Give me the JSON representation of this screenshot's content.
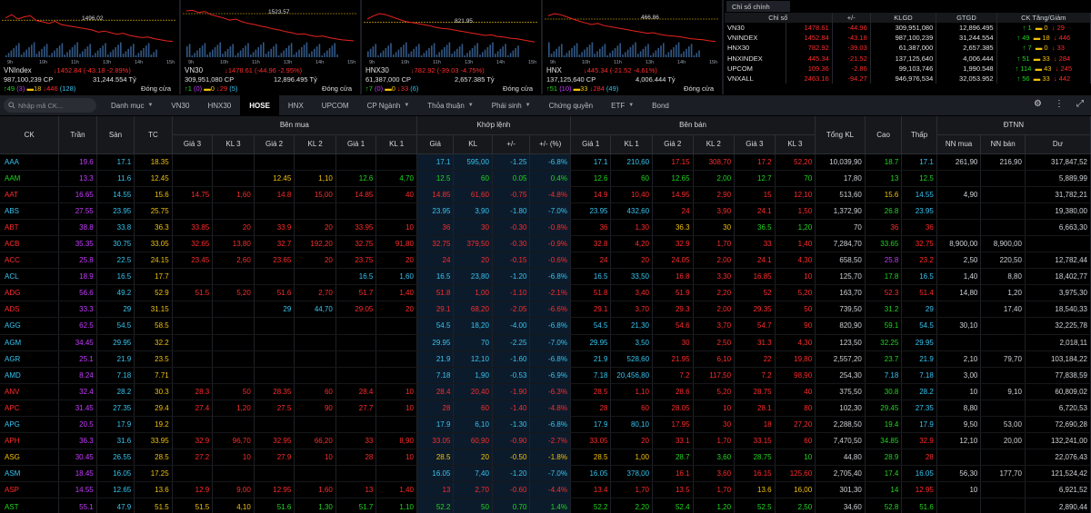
{
  "charts": [
    {
      "name": "VNIndex",
      "level": "1496.02",
      "change": "↓1452.84 (-43.18 -2.89%)",
      "volume": "987,100,239 CP",
      "value": "31,244.554 Tỷ",
      "up": "↑49",
      "ce": "(3)",
      "ref": "▬18",
      "down": "↓446",
      "fl": "(128)",
      "status": "Đóng cửa",
      "line_color": "#e8231d",
      "ref_y": 0.32,
      "line": [
        0.28,
        0.22,
        0.3,
        0.26,
        0.24,
        0.33,
        0.35,
        0.38,
        0.34,
        0.4,
        0.42,
        0.44,
        0.46,
        0.48,
        0.5,
        0.54,
        0.52,
        0.55,
        0.58,
        0.56,
        0.6,
        0.62,
        0.64,
        0.63,
        0.66,
        0.68,
        0.7,
        0.71
      ]
    },
    {
      "name": "VN30",
      "level": "1523.57",
      "change": "↓1478.61 (-44.96 -2.95%)",
      "volume": "309,951,080 CP",
      "value": "12,896.495 Tỷ",
      "up": "↑1",
      "ce": "(0)",
      "ref": "▬0",
      "down": "↓29",
      "fl": "(5)",
      "status": "Đóng cửa",
      "line_color": "#e8231d",
      "ref_y": 0.2,
      "line": [
        0.15,
        0.14,
        0.18,
        0.16,
        0.22,
        0.25,
        0.28,
        0.32,
        0.3,
        0.35,
        0.38,
        0.4,
        0.43,
        0.45,
        0.48,
        0.5,
        0.53,
        0.55,
        0.58,
        0.57,
        0.6,
        0.62,
        0.61,
        0.64,
        0.66,
        0.68,
        0.69,
        0.7
      ]
    },
    {
      "name": "HNX30",
      "level": "821.95",
      "change": "↓782.92 (-39.03 -4.75%)",
      "volume": "61,387,000 CP",
      "value": "2,657.385 Tỷ",
      "up": "↑7",
      "ce": "(0)",
      "ref": "▬0",
      "down": "↓33",
      "fl": "(6)",
      "status": "Đóng cửa",
      "line_color": "#e8231d",
      "ref_y": 0.36,
      "line": [
        0.3,
        0.24,
        0.2,
        0.22,
        0.26,
        0.3,
        0.34,
        0.36,
        0.38,
        0.4,
        0.42,
        0.45,
        0.47,
        0.48,
        0.5,
        0.52,
        0.54,
        0.56,
        0.58,
        0.6,
        0.59,
        0.62,
        0.63,
        0.65,
        0.66,
        0.68,
        0.7,
        0.72
      ]
    },
    {
      "name": "HNX",
      "level": "466.86",
      "change": "↓445.34 (-21.52 -4.61%)",
      "volume": "137,125,640 CP",
      "value": "4,006.444 Tỷ",
      "up": "↑51",
      "ce": "(10)",
      "ref": "▬33",
      "down": "↓284",
      "fl": "(49)",
      "status": "Đóng cửa",
      "line_color": "#e8231d",
      "ref_y": 0.3,
      "line": [
        0.24,
        0.2,
        0.22,
        0.26,
        0.3,
        0.34,
        0.37,
        0.4,
        0.38,
        0.42,
        0.44,
        0.46,
        0.48,
        0.5,
        0.52,
        0.54,
        0.56,
        0.55,
        0.58,
        0.6,
        0.61,
        0.62,
        0.64,
        0.66,
        0.67,
        0.68,
        0.7,
        0.71
      ]
    }
  ],
  "index_panel": {
    "tab": "Chỉ số chính",
    "headers": [
      "Chỉ số",
      "+/-",
      "KLGD",
      "GTGD",
      "CK Tăng/Giảm"
    ],
    "rows": [
      {
        "name": "VN30",
        "value": "1478.61",
        "chg": "-44.96",
        "vol": "309,951,080",
        "val": "12,896.495",
        "up": "↑ 1",
        "ref": "▬ 0",
        "down": "↓ 29"
      },
      {
        "name": "VNINDEX",
        "value": "1452.84",
        "chg": "-43.18",
        "vol": "987,100,239",
        "val": "31,244.554",
        "up": "↑ 49",
        "ref": "▬ 18",
        "down": "↓ 446"
      },
      {
        "name": "HNX30",
        "value": "782.92",
        "chg": "-39.03",
        "vol": "61,387,000",
        "val": "2,657.385",
        "up": "↑ 7",
        "ref": "▬ 0",
        "down": "↓ 33"
      },
      {
        "name": "HNXINDEX",
        "value": "445.34",
        "chg": "-21.52",
        "vol": "137,125,640",
        "val": "4,006.444",
        "up": "↑ 51",
        "ref": "▬ 33",
        "down": "↓ 284"
      },
      {
        "name": "UPCOM",
        "value": "109.36",
        "chg": "-2.86",
        "vol": "99,103,746",
        "val": "1,990.548",
        "up": "↑ 114",
        "ref": "▬ 43",
        "down": "↓ 245"
      },
      {
        "name": "VNXALL",
        "value": "2463.16",
        "chg": "-94.27",
        "vol": "946,976,534",
        "val": "32,053.952",
        "up": "↑ 56",
        "ref": "▬ 33",
        "down": "↓ 442"
      }
    ]
  },
  "toolbar": {
    "search_placeholder": "Nhập mã CK...",
    "tabs": [
      {
        "label": "Danh mục",
        "chev": true
      },
      {
        "label": "VN30",
        "chev": false
      },
      {
        "label": "HNX30",
        "chev": false
      },
      {
        "label": "HOSE",
        "chev": false,
        "active": true
      },
      {
        "label": "HNX",
        "chev": false
      },
      {
        "label": "UPCOM",
        "chev": false
      },
      {
        "label": "CP Ngành",
        "chev": true
      },
      {
        "label": "Thỏa thuận",
        "chev": true
      },
      {
        "label": "Phái sinh",
        "chev": true
      },
      {
        "label": "Chứng quyền",
        "chev": false
      },
      {
        "label": "ETF",
        "chev": true
      },
      {
        "label": "Bond",
        "chev": false
      }
    ]
  },
  "board": {
    "groups": {
      "buy": "Bên mua",
      "match": "Khớp lệnh",
      "sell": "Bên bán",
      "foreign": "ĐTNN"
    },
    "fixed_headers": {
      "ck": "CK",
      "ceil": "Trần",
      "floor": "Sàn",
      "ref": "TC",
      "total": "Tổng KL",
      "high": "Cao",
      "low": "Thấp"
    },
    "sub_headers": [
      "Giá 3",
      "KL 3",
      "Giá 2",
      "KL 2",
      "Giá 1",
      "KL 1",
      "Giá",
      "KL",
      "+/-",
      "+/- (%)",
      "Giá 1",
      "KL 1",
      "Giá 2",
      "KL 2",
      "Giá 3",
      "KL 3",
      "NN mua",
      "NN bán",
      "Dư"
    ],
    "rows": [
      [
        "AAA",
        "19.6",
        "17.1",
        "18.35",
        "",
        "",
        "",
        "",
        "",
        "",
        "17.1",
        "595,00",
        "-1.25",
        "-6.8%",
        "17.1",
        "210,60",
        "17.15",
        "308,70",
        "17.2",
        "52,20",
        "10,039,90",
        "18.7",
        "17.1",
        "261,90",
        "216,90",
        "317,847,52"
      ],
      [
        "AAM",
        "13.3",
        "11.6",
        "12.45",
        "",
        "",
        "12.45",
        "1,10",
        "12.6",
        "4,70",
        "12.5",
        "60",
        "0.05",
        "0.4%",
        "12.6",
        "60",
        "12.65",
        "2,00",
        "12.7",
        "70",
        "17,80",
        "13",
        "12.5",
        "",
        "",
        "5,889,99"
      ],
      [
        "AAT",
        "16.65",
        "14.55",
        "15.6",
        "14.75",
        "1,60",
        "14.8",
        "15,00",
        "14.85",
        "40",
        "14.85",
        "61,60",
        "-0.75",
        "-4.8%",
        "14.9",
        "10,40",
        "14.95",
        "2,90",
        "15",
        "12,10",
        "513,60",
        "15.6",
        "14.55",
        "4,90",
        "",
        "31,782,21"
      ],
      [
        "ABS",
        "27.55",
        "23.95",
        "25.75",
        "",
        "",
        "",
        "",
        "",
        "",
        "23.95",
        "3,90",
        "-1.80",
        "-7.0%",
        "23.95",
        "432,60",
        "24",
        "3,90",
        "24.1",
        "1,50",
        "1,372,90",
        "26.8",
        "23.95",
        "",
        "",
        "19,380,00"
      ],
      [
        "ABT",
        "38.8",
        "33.8",
        "36.3",
        "33.85",
        "20",
        "33.9",
        "20",
        "33.95",
        "10",
        "36",
        "30",
        "-0.30",
        "-0.8%",
        "36",
        "1,30",
        "36.3",
        "30",
        "36.5",
        "1,20",
        "70",
        "36",
        "36",
        "",
        "",
        "6,663,30"
      ],
      [
        "ACB",
        "35.35",
        "30.75",
        "33.05",
        "32.65",
        "13,80",
        "32.7",
        "192,20",
        "32.75",
        "91,80",
        "32.75",
        "379,50",
        "-0.30",
        "-0.9%",
        "32.8",
        "4,20",
        "32.9",
        "1,70",
        "33",
        "1,40",
        "7,284,70",
        "33.65",
        "32.75",
        "8,900,00",
        "8,900,00",
        ""
      ],
      [
        "ACC",
        "25.8",
        "22.5",
        "24.15",
        "23.45",
        "2,60",
        "23.65",
        "20",
        "23.75",
        "20",
        "24",
        "20",
        "-0.15",
        "-0.6%",
        "24",
        "20",
        "24.05",
        "2,00",
        "24.1",
        "4,30",
        "658,50",
        "25.8",
        "23.2",
        "2,50",
        "220,50",
        "12,782,44"
      ],
      [
        "ACL",
        "18.9",
        "16.5",
        "17.7",
        "",
        "",
        "",
        "",
        "16.5",
        "1,60",
        "16.5",
        "23,80",
        "-1.20",
        "-6.8%",
        "16.5",
        "33,50",
        "16.8",
        "3,30",
        "16.85",
        "10",
        "125,70",
        "17.8",
        "16.5",
        "1,40",
        "8,80",
        "18,402,77"
      ],
      [
        "ADG",
        "56.6",
        "49.2",
        "52.9",
        "51.5",
        "5,20",
        "51.6",
        "2,70",
        "51.7",
        "1,40",
        "51.8",
        "1,00",
        "-1.10",
        "-2.1%",
        "51.8",
        "3,40",
        "51.9",
        "2,20",
        "52",
        "5,20",
        "163,70",
        "52.3",
        "51.4",
        "14,80",
        "1,20",
        "3,975,30"
      ],
      [
        "ADS",
        "33.3",
        "29",
        "31.15",
        "",
        "",
        "29",
        "44,70",
        "29.05",
        "20",
        "29.1",
        "68,20",
        "-2.05",
        "-6.6%",
        "29.1",
        "3,70",
        "29.3",
        "2,00",
        "29.35",
        "50",
        "739,50",
        "31.2",
        "29",
        "",
        "17,40",
        "18,540,33"
      ],
      [
        "AGG",
        "62.5",
        "54.5",
        "58.5",
        "",
        "",
        "",
        "",
        "",
        "",
        "54.5",
        "18,20",
        "-4.00",
        "-6.8%",
        "54.5",
        "21,30",
        "54.6",
        "3,70",
        "54.7",
        "90",
        "820,90",
        "59.1",
        "54.5",
        "30,10",
        "",
        "32,225,78"
      ],
      [
        "AGM",
        "34.45",
        "29.95",
        "32.2",
        "",
        "",
        "",
        "",
        "",
        "",
        "29.95",
        "70",
        "-2.25",
        "-7.0%",
        "29.95",
        "3,50",
        "30",
        "2,50",
        "31.3",
        "4,30",
        "123,50",
        "32.25",
        "29.95",
        "",
        "",
        "2,018,11"
      ],
      [
        "AGR",
        "25.1",
        "21.9",
        "23.5",
        "",
        "",
        "",
        "",
        "",
        "",
        "21.9",
        "12,10",
        "-1.60",
        "-6.8%",
        "21.9",
        "528,60",
        "21.95",
        "6,10",
        "22",
        "19,80",
        "2,557,20",
        "23.7",
        "21.9",
        "2,10",
        "79,70",
        "103,184,22"
      ],
      [
        "AMD",
        "8.24",
        "7.18",
        "7.71",
        "",
        "",
        "",
        "",
        "",
        "",
        "7.18",
        "1,90",
        "-0.53",
        "-6.9%",
        "7.18",
        "20,456,80",
        "7.2",
        "117,50",
        "7.2",
        "98,90",
        "254,30",
        "7.18",
        "7.18",
        "3,00",
        "",
        "77,838,59"
      ],
      [
        "ANV",
        "32.4",
        "28.2",
        "30.3",
        "28.3",
        "50",
        "28.35",
        "60",
        "28.4",
        "10",
        "28.4",
        "20,40",
        "-1.90",
        "-6.3%",
        "28.5",
        "1,10",
        "28.6",
        "5,20",
        "28.75",
        "40",
        "375,50",
        "30.8",
        "28.2",
        "10",
        "9,10",
        "60,809,02"
      ],
      [
        "APC",
        "31.45",
        "27.35",
        "29.4",
        "27.4",
        "1,20",
        "27.5",
        "90",
        "27.7",
        "10",
        "28",
        "60",
        "-1.40",
        "-4.8%",
        "28",
        "60",
        "28.05",
        "10",
        "28.1",
        "80",
        "102,30",
        "29.45",
        "27.35",
        "8,80",
        "",
        "6,720,53"
      ],
      [
        "APG",
        "20.5",
        "17.9",
        "19.2",
        "",
        "",
        "",
        "",
        "",
        "",
        "17.9",
        "6,10",
        "-1.30",
        "-6.8%",
        "17.9",
        "80,10",
        "17.95",
        "30",
        "18",
        "27,20",
        "2,288,50",
        "19.4",
        "17.9",
        "9,50",
        "53,00",
        "72,690,28"
      ],
      [
        "APH",
        "36.3",
        "31.6",
        "33.95",
        "32.9",
        "96,70",
        "32.95",
        "66,20",
        "33",
        "8,90",
        "33.05",
        "60,90",
        "-0.90",
        "-2.7%",
        "33.05",
        "20",
        "33.1",
        "1,70",
        "33.15",
        "60",
        "7,470,50",
        "34.85",
        "32.9",
        "12,10",
        "20,00",
        "132,241,00"
      ],
      [
        "ASG",
        "30.45",
        "26.55",
        "28.5",
        "27.2",
        "10",
        "27.9",
        "10",
        "28",
        "10",
        "28.5",
        "20",
        "-0.50",
        "-1.8%",
        "28.5",
        "1,00",
        "28.7",
        "3,60",
        "28.75",
        "10",
        "44,80",
        "28.9",
        "28",
        "",
        "",
        "22,076,43"
      ],
      [
        "ASM",
        "18.45",
        "16.05",
        "17.25",
        "",
        "",
        "",
        "",
        "",
        "",
        "16.05",
        "7,40",
        "-1.20",
        "-7.0%",
        "16.05",
        "378,00",
        "16.1",
        "3,60",
        "16.15",
        "125,60",
        "2,705,40",
        "17.4",
        "16.05",
        "56,30",
        "177,70",
        "121,524,42"
      ],
      [
        "ASP",
        "14.55",
        "12.65",
        "13.6",
        "12.9",
        "9,00",
        "12.95",
        "1,60",
        "13",
        "1,40",
        "13",
        "2,70",
        "-0.60",
        "-4.4%",
        "13.4",
        "1,70",
        "13.5",
        "1,70",
        "13.6",
        "16,00",
        "301,30",
        "14",
        "12.95",
        "10",
        "",
        "6,921,52"
      ],
      [
        "AST",
        "55.1",
        "47.9",
        "51.5",
        "51.5",
        "4,10",
        "51.6",
        "1,30",
        "51.7",
        "1,10",
        "52.2",
        "50",
        "0.70",
        "1.4%",
        "52.2",
        "2,20",
        "52.4",
        "1,20",
        "52.5",
        "2,50",
        "34,60",
        "52.8",
        "51.6",
        "",
        "",
        "2,890,44"
      ]
    ]
  },
  "colors": {
    "up": "#1fd81f",
    "down": "#ff2b2b",
    "ref": "#f2c10a",
    "ceil": "#c63cff",
    "floor": "#36c4f0",
    "text": "#cfd2d6"
  }
}
